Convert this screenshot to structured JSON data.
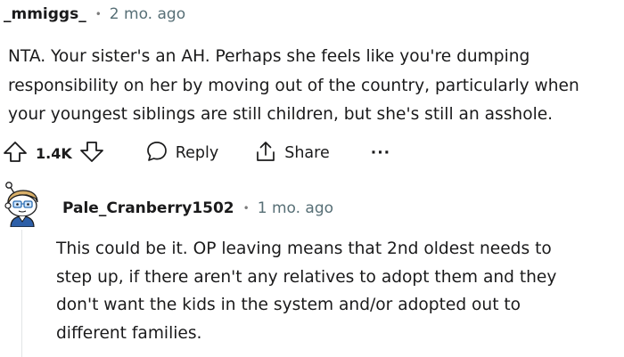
{
  "comment": {
    "author": "_mmiggs_",
    "separator": "•",
    "time": "2 mo. ago",
    "body_lines": [
      "NTA. Your sister's an AH. Perhaps she feels like you're dumping",
      "responsibility on her by moving out of the country, particularly when",
      "your youngest siblings are still children, but she's still an asshole."
    ],
    "actions": {
      "upvote_icon": "arrow-up-icon",
      "vote_count": "1.4K",
      "downvote_icon": "arrow-down-icon",
      "reply_icon": "speech-bubble-icon",
      "reply_label": "Reply",
      "share_icon": "share-icon",
      "share_label": "Share",
      "more_label": "···"
    }
  },
  "reply": {
    "author": "Pale_Cranberry1502",
    "separator": "•",
    "time": "1 mo. ago",
    "avatar_icon": "snoo-avatar-icon",
    "body_lines": [
      "This could be it. OP leaving means that 2nd oldest needs to",
      "step up, if there aren't any relatives to adopt them and they",
      "don't want the kids in the system and/or adopted out to",
      "different families."
    ]
  }
}
